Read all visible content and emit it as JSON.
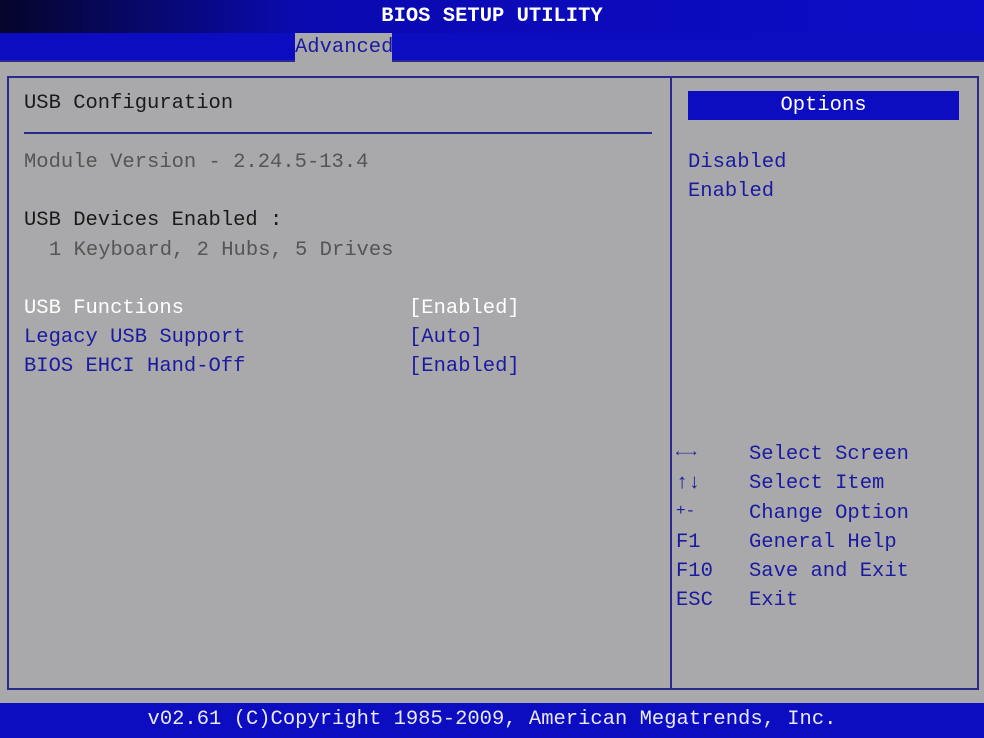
{
  "title": "BIOS SETUP UTILITY",
  "tab": "Advanced",
  "section_title": "USB Configuration",
  "module_version": "Module Version - 2.24.5-13.4",
  "devices_label": "USB Devices Enabled :",
  "devices_value": "1 Keyboard, 2 Hubs, 5 Drives",
  "settings": [
    {
      "label": "USB Functions",
      "value": "[Enabled]",
      "selected": true
    },
    {
      "label": "Legacy USB Support",
      "value": "[Auto]"
    },
    {
      "label": "BIOS EHCI Hand-Off",
      "value": "[Enabled]"
    }
  ],
  "options_title": "Options",
  "options": [
    "Disabled",
    "Enabled"
  ],
  "help": [
    {
      "key": "←→",
      "desc": "Select Screen"
    },
    {
      "key": "↑↓",
      "desc": "Select Item"
    },
    {
      "key": "+-",
      "desc": "Change Option"
    },
    {
      "key": "F1",
      "desc": "General Help"
    },
    {
      "key": "F10",
      "desc": "Save and Exit"
    },
    {
      "key": "ESC",
      "desc": "Exit"
    }
  ],
  "footer": "v02.61 (C)Copyright 1985-2009, American Megatrends, Inc."
}
